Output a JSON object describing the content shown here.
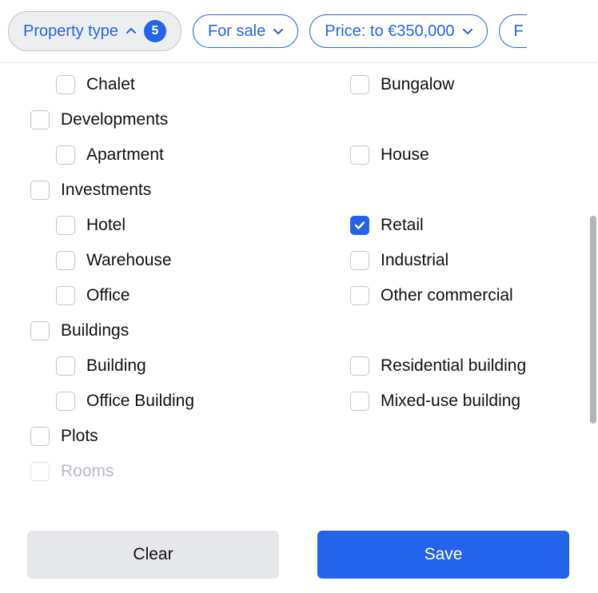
{
  "filters": {
    "property_type": {
      "label": "Property type",
      "badge": "5"
    },
    "for_sale": {
      "label": "For sale"
    },
    "price": {
      "label": "Price: to €350,000"
    },
    "cut": {
      "label": "F"
    }
  },
  "groups": [
    {
      "label": "",
      "children": [
        {
          "label": "Chalet",
          "checked": false
        },
        {
          "label": "Bungalow",
          "checked": false
        }
      ]
    },
    {
      "label": "Developments",
      "children": [
        {
          "label": "Apartment",
          "checked": false
        },
        {
          "label": "House",
          "checked": false
        }
      ]
    },
    {
      "label": "Investments",
      "children": [
        {
          "label": "Hotel",
          "checked": false
        },
        {
          "label": "Retail",
          "checked": true
        },
        {
          "label": "Warehouse",
          "checked": false
        },
        {
          "label": "Industrial",
          "checked": false
        },
        {
          "label": "Office",
          "checked": false
        },
        {
          "label": "Other commercial",
          "checked": false
        }
      ]
    },
    {
      "label": "Buildings",
      "children": [
        {
          "label": "Building",
          "checked": false
        },
        {
          "label": "Residential building",
          "checked": false
        },
        {
          "label": "Office Building",
          "checked": false
        },
        {
          "label": "Mixed-use building",
          "checked": false
        }
      ]
    },
    {
      "label": "Plots",
      "children": []
    },
    {
      "label": "Rooms",
      "disabled": true,
      "children": []
    }
  ],
  "footer": {
    "clear": "Clear",
    "save": "Save"
  }
}
